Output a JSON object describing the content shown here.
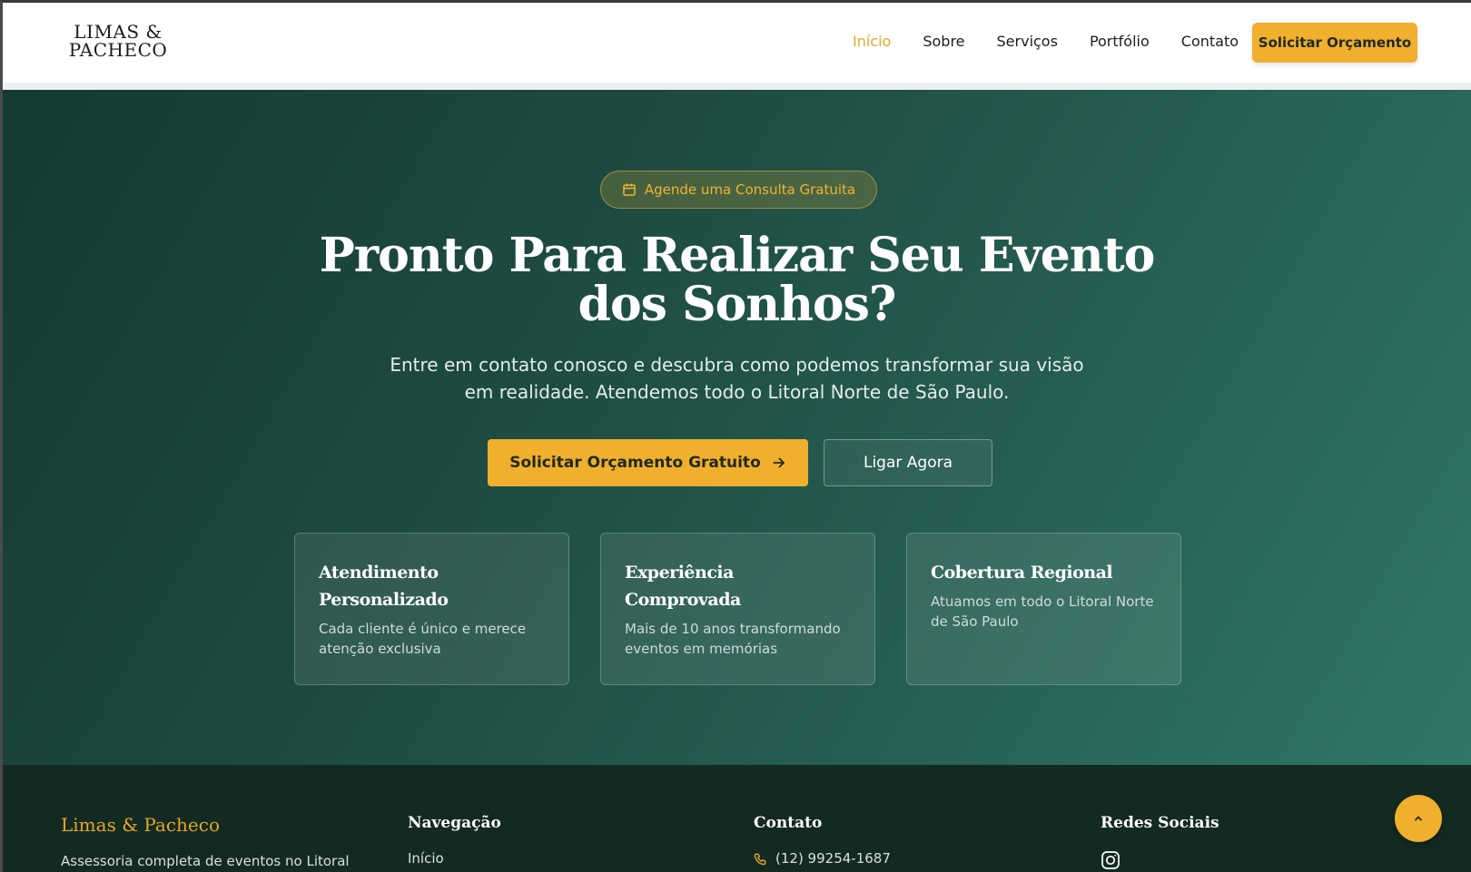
{
  "header": {
    "logo_line1": "LIMAS &",
    "logo_line2": "PACHECO",
    "nav": [
      {
        "label": "Início",
        "active": true
      },
      {
        "label": "Sobre"
      },
      {
        "label": "Serviços"
      },
      {
        "label": "Portfólio"
      },
      {
        "label": "Contato"
      }
    ],
    "cta_label": "Solicitar Orçamento"
  },
  "hero": {
    "badge_icon": "calendar-icon",
    "badge_label": "Agende uma Consulta Gratuita",
    "title": "Pronto Para Realizar Seu Evento dos Sonhos?",
    "subtitle": "Entre em contato conosco e descubra como podemos transformar sua visão em realidade. Atendemos todo o Litoral Norte de São Paulo.",
    "primary_button": "Solicitar Orçamento Gratuito",
    "primary_button_icon": "arrow-right-icon",
    "secondary_button": "Ligar Agora",
    "cards": [
      {
        "title": "Atendimento Personalizado",
        "text": "Cada cliente é único e merece atenção exclusiva"
      },
      {
        "title": "Experiência Comprovada",
        "text": "Mais de 10 anos transformando eventos em memórias"
      },
      {
        "title": "Cobertura Regional",
        "text": "Atuamos em todo o Litoral Norte de São Paulo"
      }
    ]
  },
  "footer": {
    "brand": "Limas & Pacheco",
    "description": "Assessoria completa de eventos no Litoral",
    "nav_heading": "Navegação",
    "nav_first_link": "Início",
    "contact_heading": "Contato",
    "phone": "(12) 99254-1687",
    "social_heading": "Redes Sociais",
    "social_icon": "instagram-icon"
  },
  "colors": {
    "accent": "#f0af2c",
    "hero_dark": "#143a32",
    "hero_light": "#2f7767",
    "footer_bg": "#132a23"
  }
}
